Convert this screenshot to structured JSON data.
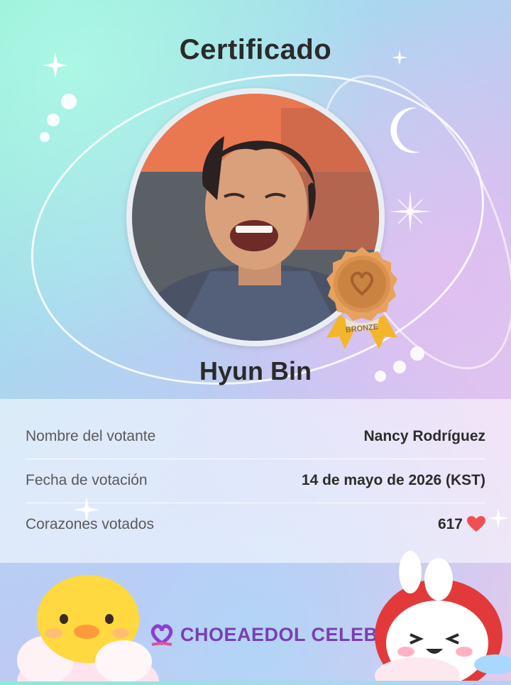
{
  "certificate": {
    "title": "Certificado",
    "celeb_name": "Hyun Bin",
    "badge_label": "BRONZE"
  },
  "details": {
    "voter_label": "Nombre del votante",
    "voter_value": "Nancy Rodríguez",
    "date_label": "Fecha de votación",
    "date_value": "14 de mayo de 2026 (KST)",
    "hearts_label": "Corazones votados",
    "hearts_value": "617"
  },
  "brand": {
    "name": "CHOEAEDOL CELEB"
  },
  "colors": {
    "badge_bronze": "#d9924f",
    "ribbon_gold": "#f3b62b",
    "heart_red": "#f0504f",
    "brand_purple": "#7a3fb0"
  },
  "icons": [
    "heart-icon",
    "bronze-badge-icon",
    "moon-icon",
    "sparkle-icon",
    "brand-logo-icon"
  ]
}
